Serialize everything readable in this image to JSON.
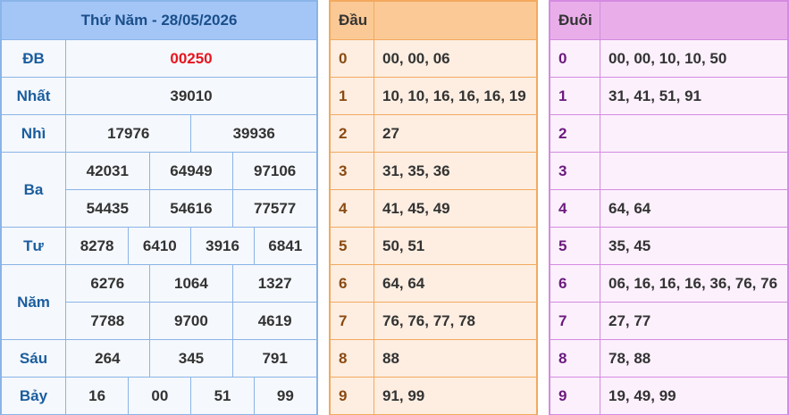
{
  "results": {
    "title": "Thứ Năm - 28/05/2026",
    "special": {
      "label": "ĐB",
      "values": [
        "00250"
      ]
    },
    "first": {
      "label": "Nhất",
      "values": [
        "39010"
      ]
    },
    "second": {
      "label": "Nhì",
      "values": [
        "17976",
        "39936"
      ]
    },
    "third": {
      "label": "Ba",
      "values": [
        "42031",
        "64949",
        "97106",
        "54435",
        "54616",
        "77577"
      ]
    },
    "fourth": {
      "label": "Tư",
      "values": [
        "8278",
        "6410",
        "3916",
        "6841"
      ]
    },
    "fifth": {
      "label": "Năm",
      "values": [
        "6276",
        "1064",
        "1327",
        "7788",
        "9700",
        "4619"
      ]
    },
    "sixth": {
      "label": "Sáu",
      "values": [
        "264",
        "345",
        "791"
      ]
    },
    "seventh": {
      "label": "Bảy",
      "values": [
        "16",
        "00",
        "51",
        "99"
      ]
    }
  },
  "dau": {
    "header": "Đầu",
    "rows": [
      {
        "digit": "0",
        "nums": "00, 00, 06"
      },
      {
        "digit": "1",
        "nums": "10, 10, 16, 16, 16, 19"
      },
      {
        "digit": "2",
        "nums": "27"
      },
      {
        "digit": "3",
        "nums": "31, 35, 36"
      },
      {
        "digit": "4",
        "nums": "41, 45, 49"
      },
      {
        "digit": "5",
        "nums": "50, 51"
      },
      {
        "digit": "6",
        "nums": "64, 64"
      },
      {
        "digit": "7",
        "nums": "76, 76, 77, 78"
      },
      {
        "digit": "8",
        "nums": "88"
      },
      {
        "digit": "9",
        "nums": "91, 99"
      }
    ]
  },
  "duoi": {
    "header": "Đuôi",
    "rows": [
      {
        "digit": "0",
        "nums": "00, 00, 10, 10, 50"
      },
      {
        "digit": "1",
        "nums": "31, 41, 51, 91"
      },
      {
        "digit": "2",
        "nums": ""
      },
      {
        "digit": "3",
        "nums": ""
      },
      {
        "digit": "4",
        "nums": "64, 64"
      },
      {
        "digit": "5",
        "nums": "35, 45"
      },
      {
        "digit": "6",
        "nums": "06, 16, 16, 16, 36, 76, 76"
      },
      {
        "digit": "7",
        "nums": "27, 77"
      },
      {
        "digit": "8",
        "nums": "78, 88"
      },
      {
        "digit": "9",
        "nums": "19, 49, 99"
      }
    ]
  }
}
